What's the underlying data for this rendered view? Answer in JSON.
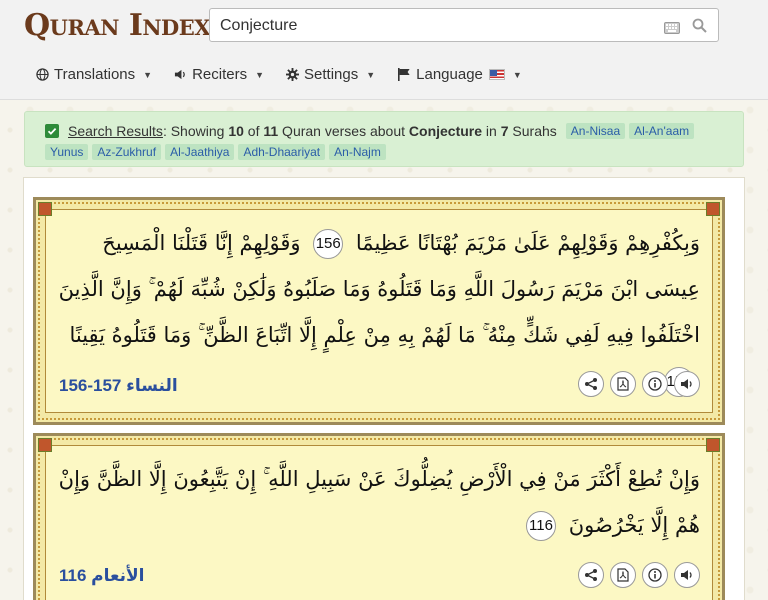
{
  "header": {
    "logo": "Quran Index",
    "search": {
      "value": "Conjecture",
      "placeholder": ""
    },
    "nav": [
      {
        "label": "Translations"
      },
      {
        "label": "Reciters"
      },
      {
        "label": "Settings"
      },
      {
        "label": "Language"
      }
    ]
  },
  "results": {
    "link": "Search Results",
    "text_showing": ": Showing ",
    "count": "10",
    "text_of": " of ",
    "total": "11",
    "text_verses": " Quran verses about ",
    "topic": "Conjecture",
    "text_in": " in ",
    "surah_count": "7",
    "text_surahs": " Surahs",
    "surahs": [
      "An-Nisaa",
      "Al-An'aam",
      "Yunus",
      "Az-Zukhruf",
      "Al-Jaathiya",
      "Adh-Dhaariyat",
      "An-Najm"
    ]
  },
  "verses": [
    {
      "text_a": "وَبِكُفْرِهِمْ وَقَوْلِهِمْ عَلَىٰ مَرْيَمَ بُهْتَانًا عَظِيمًا",
      "num_a": "156",
      "text_b": "وَقَوْلِهِمْ إِنَّا قَتَلْنَا الْمَسِيحَ عِيسَى ابْنَ مَرْيَمَ رَسُولَ اللَّهِ وَمَا قَتَلُوهُ وَمَا صَلَبُوهُ وَلَٰكِنْ شُبِّهَ لَهُمْ ۚ وَإِنَّ الَّذِينَ اخْتَلَفُوا فِيهِ لَفِي شَكٍّ مِنْهُ ۚ مَا لَهُمْ بِهِ مِنْ عِلْمٍ إِلَّا اتِّبَاعَ الظَّنِّ ۚ وَمَا قَتَلُوهُ يَقِينًا",
      "num_b": "157",
      "ref_surah": "النساء",
      "ref_range": "156-157"
    },
    {
      "text_a": "وَإِنْ تُطِعْ أَكْثَرَ مَنْ فِي الْأَرْضِ يُضِلُّوكَ عَنْ سَبِيلِ اللَّهِ ۚ إِنْ يَتَّبِعُونَ إِلَّا الظَّنَّ وَإِنْ هُمْ إِلَّا يَخْرُصُونَ",
      "num_a": "116",
      "ref_surah": "الأنعام",
      "ref_range": "116"
    }
  ],
  "colors": {
    "logo": "#6b3a1c",
    "result_bar": "#d9f0d3",
    "tag_bg": "#bde3c1",
    "tag_text": "#2a5da8",
    "verse_bg": "#fcf8c4",
    "ref_text": "#2a4f9e"
  },
  "icons": {
    "nav": [
      "globe-icon",
      "speaker-icon",
      "gear-icon",
      "flag-icon"
    ],
    "actions": [
      "share-icon",
      "pdf-icon",
      "info-icon",
      "audio-icon"
    ]
  }
}
